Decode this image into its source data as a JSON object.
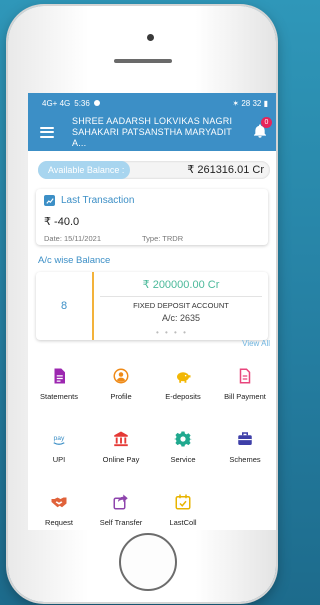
{
  "status_bar": {
    "time": "5:36",
    "signal_text": "4G+ 4G",
    "right_text": "✶ 28 32 ▮"
  },
  "header": {
    "title_line1": "SHREE AADARSH LOKVIKAS NAGRI",
    "title_line2": "SAHAKARI PATSANSTHA MARYADIT A...",
    "notification_count": "0"
  },
  "balance": {
    "label": "Available Balance :",
    "value": "₹ 261316.01 Cr"
  },
  "last_transaction": {
    "title": "Last Transaction",
    "amount": "₹ -40.0",
    "date": "Date: 15/11/2021",
    "type": "Type: TRDR"
  },
  "account_section": {
    "title": "A/c wise Balance",
    "count": "8",
    "amount": "₹ 200000.00 Cr",
    "account_name": "FIXED DEPOSIT ACCOUNT",
    "account_no": "A/c: 2635",
    "view_all": "View All"
  },
  "services": [
    {
      "label": "Statements",
      "icon": "document-icon",
      "color": "#9c27b0"
    },
    {
      "label": "Profile",
      "icon": "profile-icon",
      "color": "#ef8a17"
    },
    {
      "label": "E-deposits",
      "icon": "piggy-bank-icon",
      "color": "#f2b705"
    },
    {
      "label": "Bill Payment",
      "icon": "bill-icon",
      "color": "#e8457c"
    },
    {
      "label": "UPI",
      "icon": "pay-icon",
      "color": "#3c8fc6"
    },
    {
      "label": "Online Pay",
      "icon": "bank-icon",
      "color": "#e53935"
    },
    {
      "label": "Service",
      "icon": "gear-icon",
      "color": "#20a98f"
    },
    {
      "label": "Schemes",
      "icon": "briefcase-icon",
      "color": "#3e3fa8"
    },
    {
      "label": "Request",
      "icon": "handshake-icon",
      "color": "#e0623a"
    },
    {
      "label": "Self Transfer",
      "icon": "share-icon",
      "color": "#8e44ad"
    },
    {
      "label": "LastColl",
      "icon": "calendar-check-icon",
      "color": "#e8b400"
    }
  ]
}
